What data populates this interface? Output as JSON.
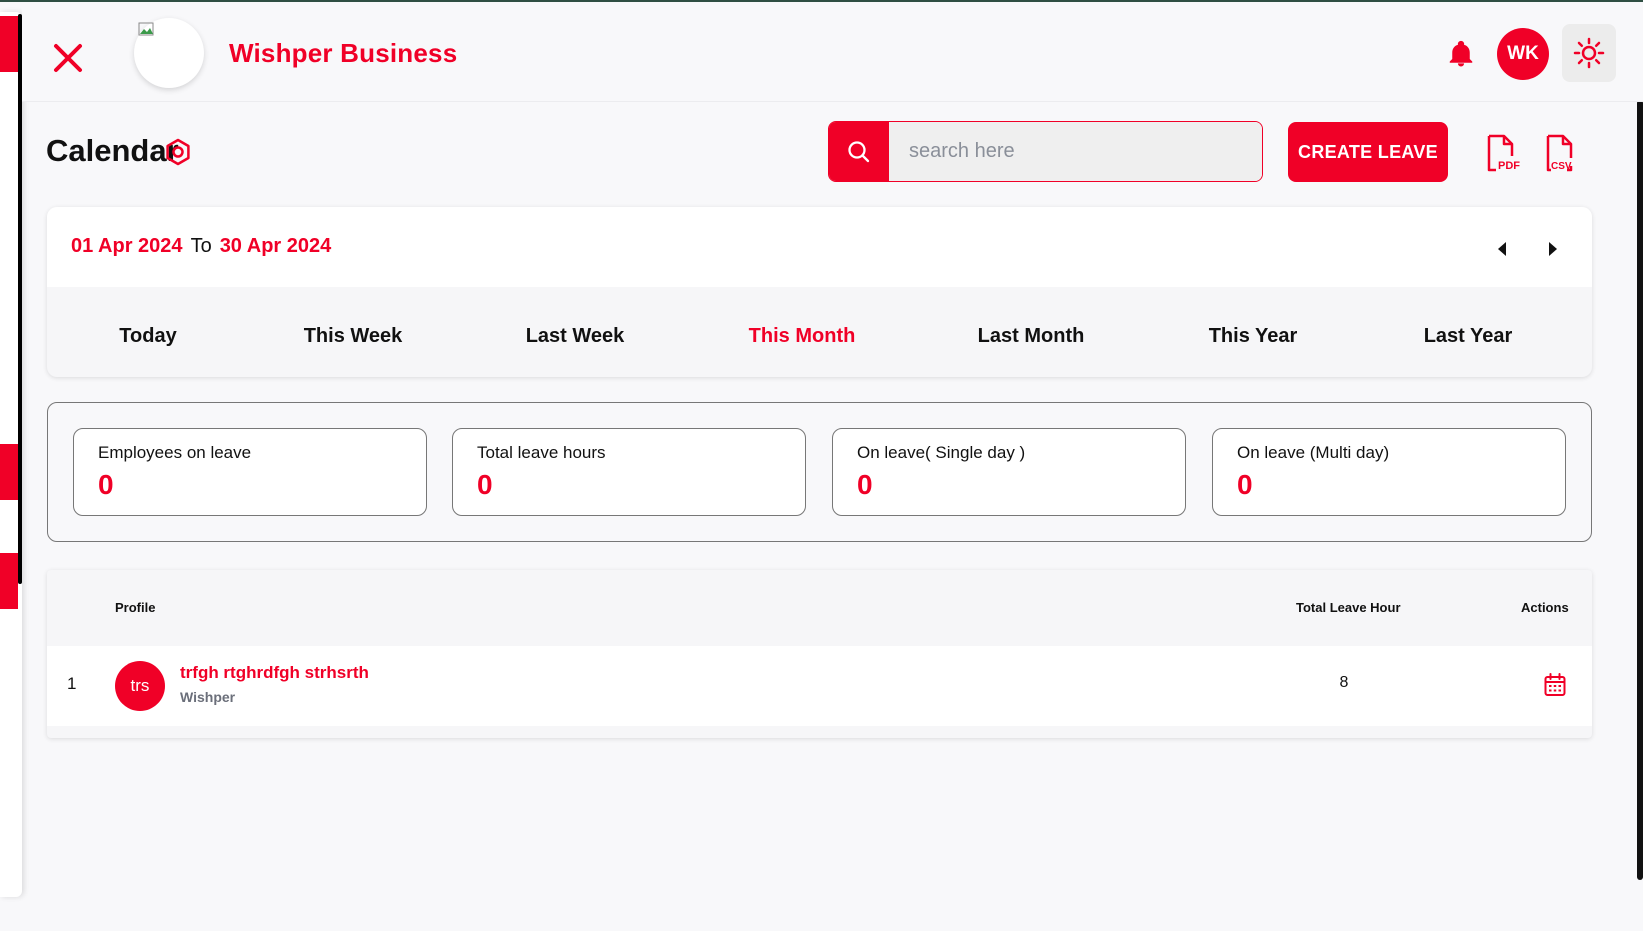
{
  "header": {
    "brand_name": "Wishper Business",
    "user_initials": "WK"
  },
  "page": {
    "title": "Calendar"
  },
  "search": {
    "placeholder": "search here",
    "value": ""
  },
  "toolbar": {
    "create_label": "CREATE LEAVE",
    "pdf_label": "PDF",
    "csv_label": "CSV"
  },
  "date_range": {
    "from": "01 Apr 2024",
    "separator": "To",
    "to": "30 Apr 2024"
  },
  "periods": [
    {
      "label": "Today",
      "active": false
    },
    {
      "label": "This Week",
      "active": false
    },
    {
      "label": "Last Week",
      "active": false
    },
    {
      "label": "This Month",
      "active": true
    },
    {
      "label": "Last Month",
      "active": false
    },
    {
      "label": "This Year",
      "active": false
    },
    {
      "label": "Last Year",
      "active": false
    }
  ],
  "stats": [
    {
      "label": "Employees on leave",
      "value": "0"
    },
    {
      "label": "Total leave hours",
      "value": "0"
    },
    {
      "label": "On leave( Single day )",
      "value": "0"
    },
    {
      "label": "On leave (Multi day)",
      "value": "0"
    }
  ],
  "table": {
    "headers": {
      "profile": "Profile",
      "hours": "Total Leave Hour",
      "actions": "Actions"
    },
    "rows": [
      {
        "index": "1",
        "avatar_text": "trs",
        "name": "trfgh rtghrdfgh strhsrth",
        "company": "Wishper",
        "hours": "8"
      }
    ]
  },
  "colors": {
    "accent": "#f00027",
    "background": "#f8f8fa",
    "text": "#111111",
    "muted": "#6b6f7a"
  },
  "icons": {
    "close": "close-icon",
    "bell": "bell-icon",
    "theme": "sun-icon",
    "title": "settings-icon",
    "search": "search-icon",
    "pdf": "pdf-file-icon",
    "csv": "csv-file-icon",
    "prev": "caret-left-icon",
    "next": "caret-right-icon",
    "row_action": "calendar-icon"
  }
}
